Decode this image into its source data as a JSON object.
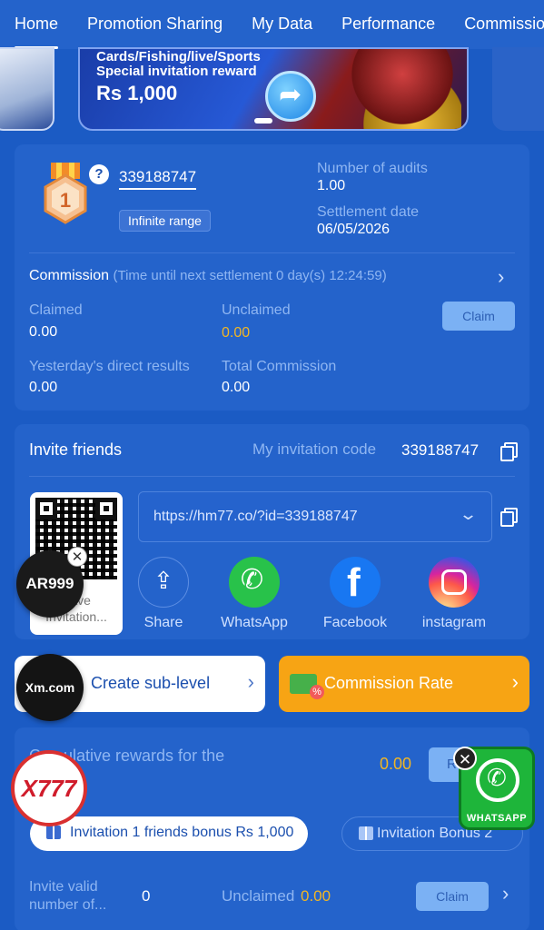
{
  "nav": {
    "tabs": [
      {
        "label": "Home",
        "active": true
      },
      {
        "label": "Promotion Sharing"
      },
      {
        "label": "My Data"
      },
      {
        "label": "Performance"
      },
      {
        "label": "Commission"
      }
    ]
  },
  "banner": {
    "line1": "Cards/Fishing/live/Sports",
    "line2": "Special invitation reward",
    "amount": "Rs 1,000"
  },
  "agent": {
    "level": "1",
    "help_icon": "?",
    "id": "339188747",
    "range_badge": "Infinite range",
    "audits_label": "Number of audits",
    "audits_value": "1.00",
    "settlement_label": "Settlement date",
    "settlement_value": "06/05/2026"
  },
  "commission": {
    "title": "Commission",
    "countdown": "(Time until next settlement 0 day(s) 12:24:59)",
    "claimed_label": "Claimed",
    "claimed_value": "0.00",
    "unclaimed_label": "Unclaimed",
    "unclaimed_value": "0.00",
    "claim_button": "Claim",
    "yesterday_label": "Yesterday's direct results",
    "yesterday_value": "0.00",
    "total_label": "Total Commission",
    "total_value": "0.00"
  },
  "invite": {
    "title": "Invite friends",
    "code_label": "My invitation code",
    "code_value": "339188747",
    "link": "https://hm77.co/?id=339188747",
    "qr_label": "Save Invitation...",
    "share_items": [
      {
        "label": "Share",
        "icon": "share-icon"
      },
      {
        "label": "WhatsApp",
        "icon": "whatsapp-icon"
      },
      {
        "label": "Facebook",
        "icon": "facebook-icon"
      },
      {
        "label": "instagram",
        "icon": "instagram-icon"
      }
    ]
  },
  "actions": {
    "sub_level": "Create sub-level",
    "commission_rate": "Commission Rate"
  },
  "rewards": {
    "cumulative_label": "Cumulative rewards for the",
    "cumulative_value": "0.00",
    "claim_button": "Re",
    "bonus_tabs": [
      {
        "label": "Invitation 1 friends bonus Rs 1,000",
        "active": true
      },
      {
        "label": "Invitation Bonus 2",
        "active": false
      }
    ],
    "valid_label": "Invite valid number of...",
    "valid_value": "0",
    "unclaimed_label": "Unclaimed",
    "unclaimed_value": "0.00",
    "claim_button2": "Claim"
  },
  "floating": {
    "ar999": "AR999",
    "xm": "Xm.com",
    "x777": "X777",
    "whatsapp": "WHATSAPP",
    "close": "✕"
  },
  "colors": {
    "background": "#1b5bc4",
    "card": "#2463cb",
    "gold": "#f2b623",
    "orange": "#f7a414",
    "muted": "#8fb6f2"
  }
}
